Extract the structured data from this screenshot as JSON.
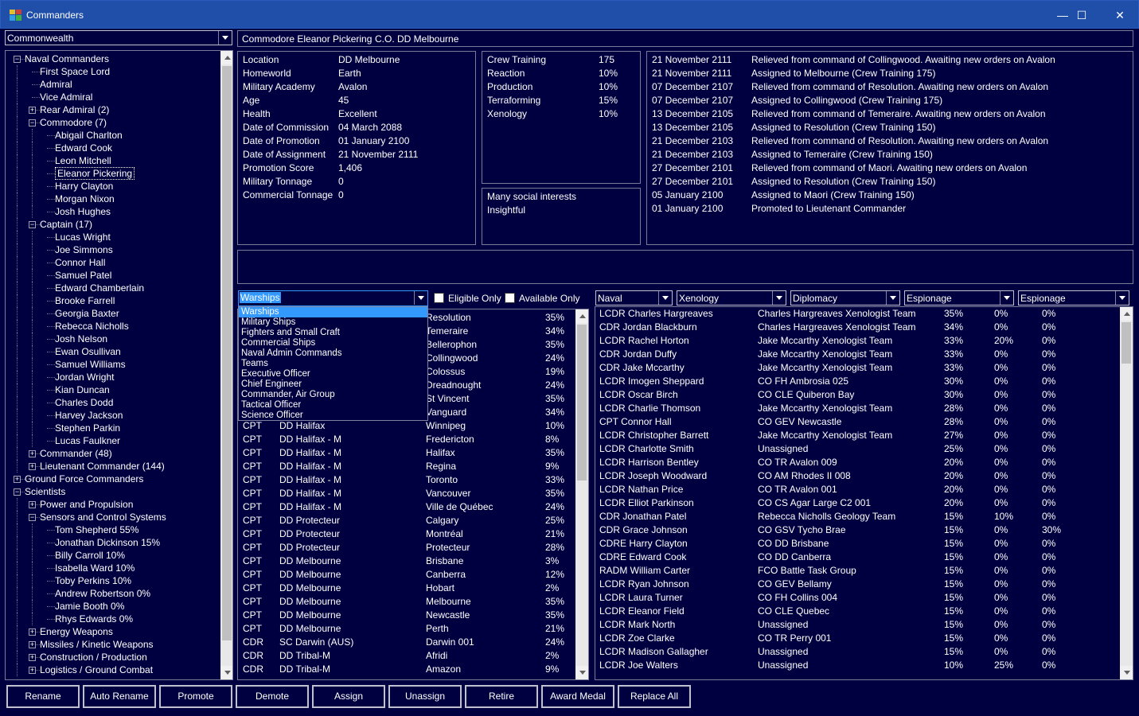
{
  "window": {
    "title": "Commanders",
    "minimize": "—",
    "maximize": "☐",
    "close": "✕"
  },
  "faction_select": {
    "value": "Commonwealth"
  },
  "tree": {
    "rows": [
      {
        "label": "Naval Commanders",
        "level": 0,
        "exp": "-"
      },
      {
        "label": "First Space Lord",
        "level": 1,
        "exp": ""
      },
      {
        "label": "Admiral",
        "level": 1,
        "exp": ""
      },
      {
        "label": "Vice Admiral",
        "level": 1,
        "exp": ""
      },
      {
        "label": "Rear Admiral (2)",
        "level": 1,
        "exp": "+"
      },
      {
        "label": "Commodore (7)",
        "level": 1,
        "exp": "-"
      },
      {
        "label": "Abigail Charlton",
        "level": 2,
        "exp": ""
      },
      {
        "label": "Edward Cook",
        "level": 2,
        "exp": ""
      },
      {
        "label": "Leon Mitchell",
        "level": 2,
        "exp": ""
      },
      {
        "label": "Eleanor Pickering",
        "level": 2,
        "exp": "",
        "selected": true
      },
      {
        "label": "Harry Clayton",
        "level": 2,
        "exp": ""
      },
      {
        "label": "Morgan Nixon",
        "level": 2,
        "exp": ""
      },
      {
        "label": "Josh Hughes",
        "level": 2,
        "exp": ""
      },
      {
        "label": "Captain (17)",
        "level": 1,
        "exp": "-"
      },
      {
        "label": "Lucas Wright",
        "level": 2,
        "exp": ""
      },
      {
        "label": "Joe Simmons",
        "level": 2,
        "exp": ""
      },
      {
        "label": "Connor Hall",
        "level": 2,
        "exp": ""
      },
      {
        "label": "Samuel Patel",
        "level": 2,
        "exp": ""
      },
      {
        "label": "Edward Chamberlain",
        "level": 2,
        "exp": ""
      },
      {
        "label": "Brooke Farrell",
        "level": 2,
        "exp": ""
      },
      {
        "label": "Georgia Baxter",
        "level": 2,
        "exp": ""
      },
      {
        "label": "Rebecca Nicholls",
        "level": 2,
        "exp": ""
      },
      {
        "label": "Josh Nelson",
        "level": 2,
        "exp": ""
      },
      {
        "label": "Ewan Osullivan",
        "level": 2,
        "exp": ""
      },
      {
        "label": "Samuel Williams",
        "level": 2,
        "exp": ""
      },
      {
        "label": "Jordan Wright",
        "level": 2,
        "exp": ""
      },
      {
        "label": "Kian Duncan",
        "level": 2,
        "exp": ""
      },
      {
        "label": "Charles Dodd",
        "level": 2,
        "exp": ""
      },
      {
        "label": "Harvey Jackson",
        "level": 2,
        "exp": ""
      },
      {
        "label": "Stephen Parkin",
        "level": 2,
        "exp": ""
      },
      {
        "label": "Lucas Faulkner",
        "level": 2,
        "exp": ""
      },
      {
        "label": "Commander (48)",
        "level": 1,
        "exp": "+"
      },
      {
        "label": "Lieutenant Commander (144)",
        "level": 1,
        "exp": "+"
      },
      {
        "label": "Ground Force Commanders",
        "level": 0,
        "exp": "+"
      },
      {
        "label": "Scientists",
        "level": 0,
        "exp": "-"
      },
      {
        "label": "Power and Propulsion",
        "level": 1,
        "exp": "+"
      },
      {
        "label": "Sensors and Control Systems",
        "level": 1,
        "exp": "-"
      },
      {
        "label": "Tom Shepherd  55%",
        "level": 2,
        "exp": ""
      },
      {
        "label": "Jonathan Dickinson  15%",
        "level": 2,
        "exp": ""
      },
      {
        "label": "Billy Carroll  10%",
        "level": 2,
        "exp": ""
      },
      {
        "label": "Isabella Ward  10%",
        "level": 2,
        "exp": ""
      },
      {
        "label": "Toby Perkins  10%",
        "level": 2,
        "exp": ""
      },
      {
        "label": "Andrew Robertson  0%",
        "level": 2,
        "exp": ""
      },
      {
        "label": "Jamie Booth  0%",
        "level": 2,
        "exp": ""
      },
      {
        "label": "Rhys Edwards  0%",
        "level": 2,
        "exp": ""
      },
      {
        "label": "Energy Weapons",
        "level": 1,
        "exp": "+"
      },
      {
        "label": "Missiles / Kinetic Weapons",
        "level": 1,
        "exp": "+"
      },
      {
        "label": "Construction / Production",
        "level": 1,
        "exp": "+"
      },
      {
        "label": "Logistics / Ground Combat",
        "level": 1,
        "exp": "+"
      }
    ]
  },
  "header": {
    "name": "Commodore Eleanor Pickering",
    "command": "C.O. DD Melbourne"
  },
  "details": [
    {
      "label": "Location",
      "value": "DD Melbourne"
    },
    {
      "label": "Homeworld",
      "value": "Earth"
    },
    {
      "label": "Military Academy",
      "value": "Avalon"
    },
    {
      "label": "Age",
      "value": "45"
    },
    {
      "label": "Health",
      "value": "Excellent"
    },
    {
      "label": "Date of Commission",
      "value": "04 March 2088"
    },
    {
      "label": "Date of Promotion",
      "value": "01 January 2100"
    },
    {
      "label": "Date of Assignment",
      "value": "21 November 2111"
    },
    {
      "label": "Promotion Score",
      "value": "1,406"
    },
    {
      "label": "Military Tonnage",
      "value": "0"
    },
    {
      "label": "Commercial Tonnage",
      "value": "0"
    }
  ],
  "bonuses": [
    {
      "label": "Crew Training",
      "value": "175"
    },
    {
      "label": "Reaction",
      "value": "10%"
    },
    {
      "label": "Production",
      "value": "10%"
    },
    {
      "label": "Terraforming",
      "value": "15%"
    },
    {
      "label": "Xenology",
      "value": "10%"
    }
  ],
  "traits": [
    "Many social interests",
    "Insightful"
  ],
  "history": [
    {
      "date": "21 November 2111",
      "event": "Relieved from command of Collingwood. Awaiting new orders on Avalon"
    },
    {
      "date": "21 November 2111",
      "event": "Assigned to Melbourne (Crew Training 175)"
    },
    {
      "date": "07 December 2107",
      "event": "Relieved from command of Resolution. Awaiting new orders on Avalon"
    },
    {
      "date": "07 December 2107",
      "event": "Assigned to Collingwood (Crew Training 175)"
    },
    {
      "date": "13 December 2105",
      "event": "Relieved from command of Temeraire. Awaiting new orders on Avalon"
    },
    {
      "date": "13 December 2105",
      "event": "Assigned to Resolution (Crew Training 150)"
    },
    {
      "date": "21 December 2103",
      "event": "Relieved from command of Resolution. Awaiting new orders on Avalon"
    },
    {
      "date": "21 December 2103",
      "event": "Assigned to Temeraire (Crew Training 150)"
    },
    {
      "date": "27 December 2101",
      "event": "Relieved from command of Maori. Awaiting new orders on Avalon"
    },
    {
      "date": "27 December 2101",
      "event": "Assigned to Resolution (Crew Training 150)"
    },
    {
      "date": "05 January 2100",
      "event": "Assigned to Maori (Crew Training 150)"
    },
    {
      "date": "01 January 2100",
      "event": "Promoted to Lieutenant Commander"
    }
  ],
  "ship_filter": {
    "selected": "Warships",
    "options": [
      "Warships",
      "Military Ships",
      "Fighters and Small Craft",
      "Commercial Ships",
      "Naval Admin Commands",
      "Teams",
      "Executive Officer",
      "Chief Engineer",
      "Commander, Air Group",
      "Tactical Officer",
      "Science Officer"
    ],
    "eligible_only": "Eligible Only",
    "available_only": "Available Only"
  },
  "ships_partial": [
    {
      "name": "Resolution",
      "value": "35%"
    },
    {
      "name": "Temeraire",
      "value": "34%"
    },
    {
      "name": "Bellerophon",
      "value": "35%"
    },
    {
      "name": "Collingwood",
      "value": "24%"
    },
    {
      "name": "Colossus",
      "value": "19%"
    },
    {
      "name": "Dreadnought",
      "value": "24%"
    },
    {
      "name": "St Vincent",
      "value": "35%"
    },
    {
      "name": "Vanguard",
      "value": "34%"
    }
  ],
  "ships": [
    {
      "rank": "CPT",
      "class": "DD Halifax",
      "name": "Winnipeg",
      "value": "10%"
    },
    {
      "rank": "CPT",
      "class": "DD Halifax - M",
      "name": "Fredericton",
      "value": "8%"
    },
    {
      "rank": "CPT",
      "class": "DD Halifax - M",
      "name": "Halifax",
      "value": "35%"
    },
    {
      "rank": "CPT",
      "class": "DD Halifax - M",
      "name": "Regina",
      "value": "9%"
    },
    {
      "rank": "CPT",
      "class": "DD Halifax - M",
      "name": "Toronto",
      "value": "33%"
    },
    {
      "rank": "CPT",
      "class": "DD Halifax - M",
      "name": "Vancouver",
      "value": "35%"
    },
    {
      "rank": "CPT",
      "class": "DD Halifax - M",
      "name": "Ville de Québec",
      "value": "24%"
    },
    {
      "rank": "CPT",
      "class": "DD Protecteur",
      "name": "Calgary",
      "value": "25%"
    },
    {
      "rank": "CPT",
      "class": "DD Protecteur",
      "name": "Montréal",
      "value": "21%"
    },
    {
      "rank": "CPT",
      "class": "DD Protecteur",
      "name": "Protecteur",
      "value": "28%"
    },
    {
      "rank": "CPT",
      "class": "DD Melbourne",
      "name": "Brisbane",
      "value": "3%"
    },
    {
      "rank": "CPT",
      "class": "DD Melbourne",
      "name": "Canberra",
      "value": "12%"
    },
    {
      "rank": "CPT",
      "class": "DD Melbourne",
      "name": "Hobart",
      "value": "2%"
    },
    {
      "rank": "CPT",
      "class": "DD Melbourne",
      "name": "Melbourne",
      "value": "35%"
    },
    {
      "rank": "CPT",
      "class": "DD Melbourne",
      "name": "Newcastle",
      "value": "35%"
    },
    {
      "rank": "CPT",
      "class": "DD Melbourne",
      "name": "Perth",
      "value": "21%"
    },
    {
      "rank": "CDR",
      "class": "SC Darwin (AUS)",
      "name": "Darwin 001",
      "value": "24%"
    },
    {
      "rank": "CDR",
      "class": "DD Tribal-M",
      "name": "Afridi",
      "value": "2%"
    },
    {
      "rank": "CDR",
      "class": "DD Tribal-M",
      "name": "Amazon",
      "value": "9%"
    }
  ],
  "officer_filters": [
    "Naval",
    "Xenology",
    "Diplomacy",
    "Espionage",
    "Espionage"
  ],
  "officers": [
    {
      "name": "LCDR Charles Hargreaves",
      "assignment": "Charles Hargreaves Xenologist Team",
      "v1": "35%",
      "v2": "0%",
      "v3": "0%"
    },
    {
      "name": "CDR Jordan Blackburn",
      "assignment": "Charles Hargreaves Xenologist Team",
      "v1": "34%",
      "v2": "0%",
      "v3": "0%"
    },
    {
      "name": "LCDR Rachel Horton",
      "assignment": "Jake Mccarthy Xenologist Team",
      "v1": "33%",
      "v2": "20%",
      "v3": "0%"
    },
    {
      "name": "CDR Jordan Duffy",
      "assignment": "Jake Mccarthy Xenologist Team",
      "v1": "33%",
      "v2": "0%",
      "v3": "0%"
    },
    {
      "name": "CDR Jake Mccarthy",
      "assignment": "Jake Mccarthy Xenologist Team",
      "v1": "33%",
      "v2": "0%",
      "v3": "0%"
    },
    {
      "name": "LCDR Imogen Sheppard",
      "assignment": "CO FH Ambrosia 025",
      "v1": "30%",
      "v2": "0%",
      "v3": "0%"
    },
    {
      "name": "LCDR Oscar Birch",
      "assignment": "CO CLE Quiberon Bay",
      "v1": "30%",
      "v2": "0%",
      "v3": "0%"
    },
    {
      "name": "LCDR Charlie Thomson",
      "assignment": "Jake Mccarthy Xenologist Team",
      "v1": "28%",
      "v2": "0%",
      "v3": "0%"
    },
    {
      "name": "CPT Connor Hall",
      "assignment": "CO GEV Newcastle",
      "v1": "28%",
      "v2": "0%",
      "v3": "0%"
    },
    {
      "name": "LCDR Christopher Barrett",
      "assignment": "Jake Mccarthy Xenologist Team",
      "v1": "27%",
      "v2": "0%",
      "v3": "0%"
    },
    {
      "name": "LCDR Charlotte Smith",
      "assignment": "Unassigned",
      "v1": "25%",
      "v2": "0%",
      "v3": "0%"
    },
    {
      "name": "LCDR Harrison Bentley",
      "assignment": "CO TR Avalon 009",
      "v1": "20%",
      "v2": "0%",
      "v3": "0%"
    },
    {
      "name": "LCDR Joseph Woodward",
      "assignment": "CO AM Rhodes II 008",
      "v1": "20%",
      "v2": "0%",
      "v3": "0%"
    },
    {
      "name": "LCDR Nathan Price",
      "assignment": "CO TR Avalon 001",
      "v1": "20%",
      "v2": "0%",
      "v3": "0%"
    },
    {
      "name": "LCDR Elliot Parkinson",
      "assignment": "CO CS Agar Large C2 001",
      "v1": "20%",
      "v2": "0%",
      "v3": "0%"
    },
    {
      "name": "CDR Jonathan Patel",
      "assignment": "Rebecca Nicholls Geology Team",
      "v1": "15%",
      "v2": "10%",
      "v3": "0%"
    },
    {
      "name": "CDR Grace Johnson",
      "assignment": "CO GSV Tycho Brae",
      "v1": "15%",
      "v2": "0%",
      "v3": "30%"
    },
    {
      "name": "CDRE Harry Clayton",
      "assignment": "CO DD Brisbane",
      "v1": "15%",
      "v2": "0%",
      "v3": "0%"
    },
    {
      "name": "CDRE Edward Cook",
      "assignment": "CO DD Canberra",
      "v1": "15%",
      "v2": "0%",
      "v3": "0%"
    },
    {
      "name": "RADM William Carter",
      "assignment": "FCO Battle Task Group",
      "v1": "15%",
      "v2": "0%",
      "v3": "0%"
    },
    {
      "name": "LCDR Ryan Johnson",
      "assignment": "CO GEV Bellamy",
      "v1": "15%",
      "v2": "0%",
      "v3": "0%"
    },
    {
      "name": "LCDR Laura Turner",
      "assignment": "CO FH Collins 004",
      "v1": "15%",
      "v2": "0%",
      "v3": "0%"
    },
    {
      "name": "LCDR Eleanor Field",
      "assignment": "CO CLE Quebec",
      "v1": "15%",
      "v2": "0%",
      "v3": "0%"
    },
    {
      "name": "LCDR Mark North",
      "assignment": "Unassigned",
      "v1": "15%",
      "v2": "0%",
      "v3": "0%"
    },
    {
      "name": "LCDR Zoe Clarke",
      "assignment": "CO TR Perry 001",
      "v1": "15%",
      "v2": "0%",
      "v3": "0%"
    },
    {
      "name": "LCDR Madison Gallagher",
      "assignment": "Unassigned",
      "v1": "15%",
      "v2": "0%",
      "v3": "0%"
    },
    {
      "name": "LCDR Joe Walters",
      "assignment": "Unassigned",
      "v1": "10%",
      "v2": "25%",
      "v3": "0%"
    }
  ],
  "buttons": [
    "Rename",
    "Auto Rename",
    "Promote",
    "Demote",
    "Assign",
    "Unassign",
    "Retire",
    "Award Medal",
    "Replace All"
  ],
  "colors": {
    "background": "#000040",
    "titlebar": "#1f4fa8",
    "selection": "#3399ff"
  },
  "icons": {
    "app": "grid-app-icon",
    "expand": "plus-box-icon",
    "collapse": "minus-box-icon"
  }
}
